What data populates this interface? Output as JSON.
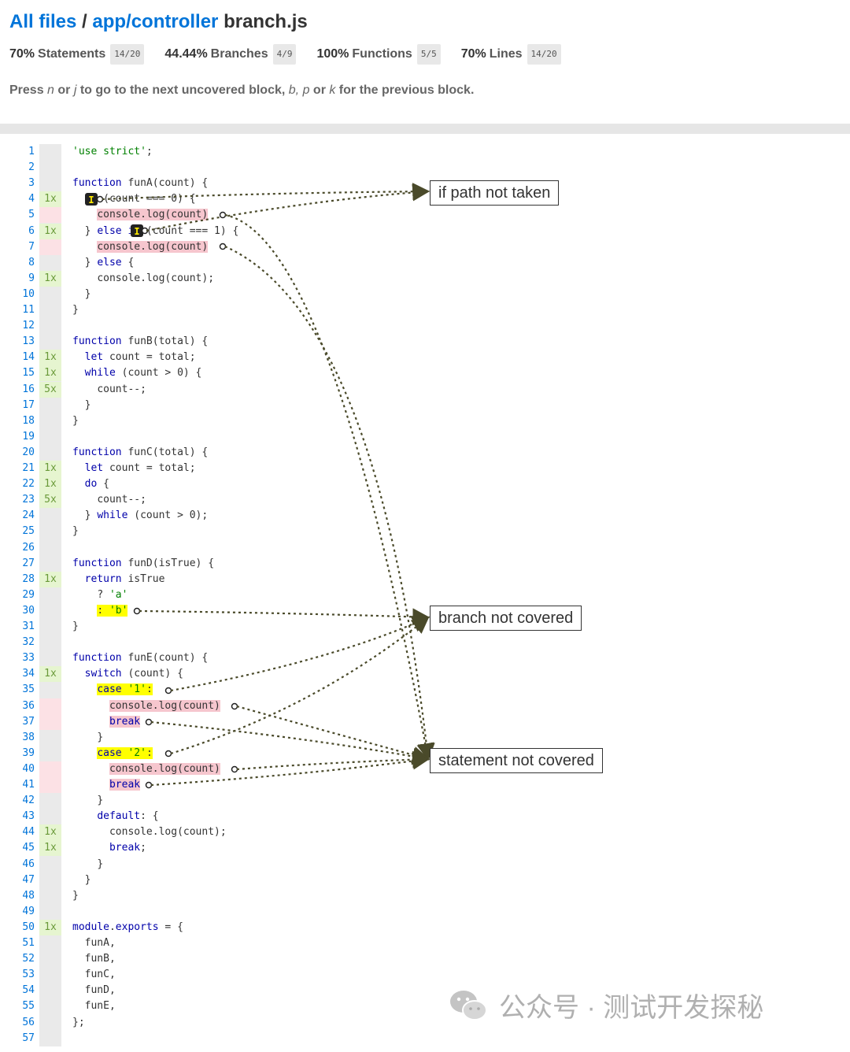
{
  "breadcrumb": {
    "all_files": "All files",
    "sep": " / ",
    "dir": "app/controller",
    "file": "branch.js"
  },
  "stats": [
    {
      "pct": "70%",
      "label": "Statements",
      "frac": "14/20"
    },
    {
      "pct": "44.44%",
      "label": "Branches",
      "frac": "4/9"
    },
    {
      "pct": "100%",
      "label": "Functions",
      "frac": "5/5"
    },
    {
      "pct": "70%",
      "label": "Lines",
      "frac": "14/20"
    }
  ],
  "hint": {
    "p1": "Press ",
    "k1": "n",
    "p2": " or ",
    "k2": "j",
    "p3": " to go to the next uncovered block, ",
    "k3": "b,",
    "p4": " ",
    "k4": "p",
    "p5": " or ",
    "k5": "k",
    "p6": " for the previous block."
  },
  "legends": {
    "if_path": "if path not taken",
    "branch": "branch not covered",
    "statement": "statement not covered"
  },
  "colors": {
    "link": "#0074d9",
    "uncovered": "#f6c6ce",
    "branch": "#ffff00",
    "covered": "#e6f5d0",
    "arrow": "#4a4a2a"
  },
  "code_lines": [
    "'use strict';",
    "",
    "function funA(count) {",
    "  if (count === 0) {",
    "    console.log(count)",
    "  } else if (count === 1) {",
    "    console.log(count)",
    "  } else {",
    "    console.log(count);",
    "  }",
    "}",
    "",
    "function funB(total) {",
    "  let count = total;",
    "  while (count > 0) {",
    "    count--;",
    "  }",
    "}",
    "",
    "function funC(total) {",
    "  let count = total;",
    "  do {",
    "    count--;",
    "  } while (count > 0);",
    "}",
    "",
    "function funD(isTrue) {",
    "  return isTrue",
    "    ? 'a'",
    "    : 'b'",
    "}",
    "",
    "function funE(count) {",
    "  switch (count) {",
    "    case '1':",
    "      console.log(count)",
    "      break",
    "    }",
    "    case '2':",
    "      console.log(count)",
    "      break",
    "    }",
    "    default: {",
    "      console.log(count);",
    "      break;",
    "    }",
    "  }",
    "}",
    "",
    "module.exports = {",
    "  funA,",
    "  funB,",
    "  funC,",
    "  funD,",
    "  funE,",
    "};",
    ""
  ],
  "hits": {
    "4": "1x",
    "6": "1x",
    "9": "1x",
    "14": "1x",
    "15": "1x",
    "16": "5x",
    "21": "1x",
    "22": "1x",
    "23": "5x",
    "28": "1x",
    "34": "1x",
    "44": "1x",
    "45": "1x",
    "50": "1x"
  },
  "uncovered_lines": [
    5,
    7,
    36,
    37,
    40,
    41
  ],
  "branch_lines": [
    30,
    35,
    39
  ],
  "watermark": {
    "text": "公众号 · 测试开发探秘"
  }
}
